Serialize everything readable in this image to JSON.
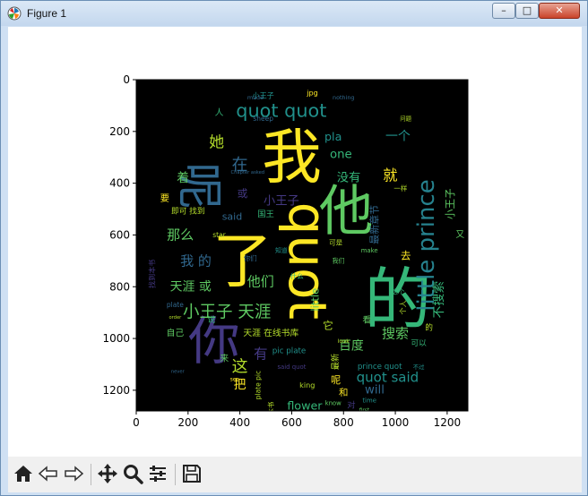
{
  "window": {
    "title": "Figure 1",
    "minimize_glyph": "–",
    "maximize_glyph": "□",
    "close_glyph": "✕",
    "app_icon": "matplotlib-logo-icon"
  },
  "toolbar": {
    "icons": [
      "home-icon",
      "back-arrow-icon",
      "forward-arrow-icon",
      "pan-move-icon",
      "zoom-magnifier-icon",
      "configure-subplots-icon",
      "save-floppy-icon"
    ]
  },
  "chart_data": {
    "type": "image",
    "description_kind": "word-cloud",
    "xlim": [
      0,
      1280
    ],
    "ylim": [
      1280,
      0
    ],
    "x_ticks": [
      0,
      200,
      400,
      600,
      800,
      1000,
      1200
    ],
    "y_ticks": [
      0,
      200,
      400,
      600,
      800,
      1000,
      1200
    ],
    "x_tick_labels": [
      "0",
      "200",
      "400",
      "600",
      "800",
      "1000",
      "1200"
    ],
    "y_tick_labels": [
      "0",
      "200",
      "400",
      "600",
      "800",
      "1000",
      "1200"
    ],
    "background_color": "#000000",
    "words": [
      {
        "text": "我",
        "x": 600,
        "y": 300,
        "size": 230,
        "color": "#fde725",
        "rotate": 0
      },
      {
        "text": "的",
        "x": 1010,
        "y": 850,
        "size": 260,
        "color": "#35b779",
        "rotate": 0
      },
      {
        "text": "quot",
        "x": 660,
        "y": 700,
        "size": 200,
        "color": "#fde725",
        "rotate": 90
      },
      {
        "text": "了",
        "x": 410,
        "y": 700,
        "size": 230,
        "color": "#fde725",
        "rotate": 0
      },
      {
        "text": "你",
        "x": 300,
        "y": 1010,
        "size": 200,
        "color": "#443983",
        "rotate": 0
      },
      {
        "text": "他",
        "x": 810,
        "y": 510,
        "size": 210,
        "color": "#5ec962",
        "rotate": 0
      },
      {
        "text": "呢",
        "x": 240,
        "y": 410,
        "size": 180,
        "color": "#31688e",
        "rotate": 90
      },
      {
        "text": "little prince",
        "x": 1120,
        "y": 640,
        "size": 90,
        "color": "#26828e",
        "rotate": -90
      },
      {
        "text": "quot quot",
        "x": 560,
        "y": 120,
        "size": 72,
        "color": "#21918c",
        "rotate": 0
      },
      {
        "text": "小王子 天涯",
        "x": 350,
        "y": 900,
        "size": 64,
        "color": "#5ec962",
        "rotate": 0
      },
      {
        "text": "quot said",
        "x": 970,
        "y": 1150,
        "size": 52,
        "color": "#21918c",
        "rotate": 0
      },
      {
        "text": "就",
        "x": 980,
        "y": 370,
        "size": 56,
        "color": "#fde725",
        "rotate": 0
      },
      {
        "text": "她",
        "x": 310,
        "y": 240,
        "size": 58,
        "color": "#b5de2b",
        "rotate": 0
      },
      {
        "text": "在",
        "x": 400,
        "y": 330,
        "size": 62,
        "color": "#31688e",
        "rotate": 0
      },
      {
        "text": "那么",
        "x": 170,
        "y": 600,
        "size": 52,
        "color": "#5ec962",
        "rotate": 0
      },
      {
        "text": "我 的",
        "x": 230,
        "y": 700,
        "size": 52,
        "color": "#31688e",
        "rotate": 0
      },
      {
        "text": "天涯 或",
        "x": 210,
        "y": 800,
        "size": 48,
        "color": "#5ec962",
        "rotate": 0
      },
      {
        "text": "他们",
        "x": 480,
        "y": 780,
        "size": 52,
        "color": "#5ec962",
        "rotate": 0
      },
      {
        "text": "小王子",
        "x": 560,
        "y": 470,
        "size": 46,
        "color": "#443983",
        "rotate": 0
      },
      {
        "text": "没有",
        "x": 820,
        "y": 380,
        "size": 46,
        "color": "#35b779",
        "rotate": 0
      },
      {
        "text": "one",
        "x": 790,
        "y": 290,
        "size": 46,
        "color": "#35b779",
        "rotate": 0
      },
      {
        "text": "一个",
        "x": 1010,
        "y": 220,
        "size": 48,
        "color": "#21918c",
        "rotate": 0
      },
      {
        "text": "这",
        "x": 400,
        "y": 1110,
        "size": 62,
        "color": "#b5de2b",
        "rotate": 0
      },
      {
        "text": "有",
        "x": 480,
        "y": 1060,
        "size": 54,
        "color": "#443983",
        "rotate": 0
      },
      {
        "text": "把",
        "x": 400,
        "y": 1180,
        "size": 48,
        "color": "#fde725",
        "rotate": 0
      },
      {
        "text": "百度",
        "x": 830,
        "y": 1030,
        "size": 48,
        "color": "#5ec962",
        "rotate": 0
      },
      {
        "text": "搜索",
        "x": 1000,
        "y": 980,
        "size": 52,
        "color": "#5ec962",
        "rotate": 0
      },
      {
        "text": "不搜索",
        "x": 1170,
        "y": 850,
        "size": 48,
        "color": "#35b779",
        "rotate": -90
      },
      {
        "text": "little",
        "x": 690,
        "y": 850,
        "size": 40,
        "color": "#5ec962",
        "rotate": -90
      },
      {
        "text": "will",
        "x": 920,
        "y": 1200,
        "size": 46,
        "color": "#31688e",
        "rotate": 0
      },
      {
        "text": "flower",
        "x": 650,
        "y": 1260,
        "size": 44,
        "color": "#35b779",
        "rotate": 0
      },
      {
        "text": "着",
        "x": 180,
        "y": 380,
        "size": 48,
        "color": "#5ec962",
        "rotate": 0
      },
      {
        "text": "pla",
        "x": 760,
        "y": 220,
        "size": 44,
        "color": "#21918c",
        "rotate": 0
      },
      {
        "text": "小王子",
        "x": 1210,
        "y": 480,
        "size": 40,
        "color": "#5ec962",
        "rotate": -90
      },
      {
        "text": "最新章节",
        "x": 920,
        "y": 560,
        "size": 38,
        "color": "#31688e",
        "rotate": -90
      },
      {
        "text": "said",
        "x": 370,
        "y": 530,
        "size": 38,
        "color": "#31688e",
        "rotate": 0
      },
      {
        "text": "或",
        "x": 410,
        "y": 440,
        "size": 40,
        "color": "#443983",
        "rotate": 0
      },
      {
        "text": "即可 找到",
        "x": 200,
        "y": 510,
        "size": 30,
        "color": "#b5de2b",
        "rotate": 0
      },
      {
        "text": "去",
        "x": 1040,
        "y": 680,
        "size": 40,
        "color": "#fde725",
        "rotate": 0
      },
      {
        "text": "天涯 在线书库",
        "x": 520,
        "y": 980,
        "size": 34,
        "color": "#b5de2b",
        "rotate": 0
      },
      {
        "text": "prince quot",
        "x": 940,
        "y": 1110,
        "size": 30,
        "color": "#21918c",
        "rotate": 0
      },
      {
        "text": "pic plate",
        "x": 590,
        "y": 1050,
        "size": 30,
        "color": "#21918c",
        "rotate": 0
      },
      {
        "text": "小王子",
        "x": 490,
        "y": 60,
        "size": 28,
        "color": "#21918c",
        "rotate": 0
      },
      {
        "text": "jpg",
        "x": 680,
        "y": 50,
        "size": 28,
        "color": "#fde725",
        "rotate": 0
      },
      {
        "text": "国王",
        "x": 500,
        "y": 520,
        "size": 32,
        "color": "#35b779",
        "rotate": 0
      },
      {
        "text": "star",
        "x": 320,
        "y": 600,
        "size": 26,
        "color": "#b5de2b",
        "rotate": 0
      },
      {
        "text": "make",
        "x": 900,
        "y": 660,
        "size": 24,
        "color": "#5ec962",
        "rotate": 0
      },
      {
        "text": "呢",
        "x": 770,
        "y": 1160,
        "size": 38,
        "color": "#fde725",
        "rotate": 0
      },
      {
        "text": "和",
        "x": 800,
        "y": 1210,
        "size": 36,
        "color": "#fde725",
        "rotate": 0
      },
      {
        "text": "king",
        "x": 660,
        "y": 1180,
        "size": 28,
        "color": "#b5de2b",
        "rotate": 0
      },
      {
        "text": "know",
        "x": 760,
        "y": 1250,
        "size": 24,
        "color": "#5ec962",
        "rotate": 0
      },
      {
        "text": "自己",
        "x": 150,
        "y": 980,
        "size": 34,
        "color": "#5ec962",
        "rotate": 0
      },
      {
        "text": "说",
        "x": 290,
        "y": 930,
        "size": 30,
        "color": "#35b779",
        "rotate": 0
      },
      {
        "text": "又",
        "x": 1250,
        "y": 600,
        "size": 34,
        "color": "#5ec962",
        "rotate": 0
      },
      {
        "text": "要",
        "x": 110,
        "y": 460,
        "size": 36,
        "color": "#fde725",
        "rotate": 0
      },
      {
        "text": "本书",
        "x": 520,
        "y": 1270,
        "size": 26,
        "color": "#b5de2b",
        "rotate": -90
      },
      {
        "text": "plate pic",
        "x": 470,
        "y": 1180,
        "size": 26,
        "color": "#b5de2b",
        "rotate": -90
      },
      {
        "text": "最新",
        "x": 770,
        "y": 1090,
        "size": 32,
        "color": "#b5de2b",
        "rotate": -90
      },
      {
        "text": "它",
        "x": 740,
        "y": 950,
        "size": 40,
        "color": "#b5de2b",
        "rotate": 0
      },
      {
        "text": "人",
        "x": 320,
        "y": 130,
        "size": 34,
        "color": "#35b779",
        "rotate": 0
      },
      {
        "text": "sheep",
        "x": 490,
        "y": 150,
        "size": 26,
        "color": "#31688e",
        "rotate": 0
      },
      {
        "text": "来",
        "x": 340,
        "y": 1080,
        "size": 34,
        "color": "#5ec962",
        "rotate": 0
      },
      {
        "text": "对",
        "x": 830,
        "y": 1260,
        "size": 32,
        "color": "#443983",
        "rotate": 0
      },
      {
        "text": "time",
        "x": 900,
        "y": 1240,
        "size": 24,
        "color": "#21918c",
        "rotate": 0
      },
      {
        "text": "看",
        "x": 890,
        "y": 930,
        "size": 34,
        "color": "#5ec962",
        "rotate": 0
      },
      {
        "text": "可以",
        "x": 1090,
        "y": 1020,
        "size": 30,
        "color": "#35b779",
        "rotate": 0
      },
      {
        "text": "的",
        "x": 1130,
        "y": 960,
        "size": 30,
        "color": "#b5de2b",
        "rotate": 0
      },
      {
        "text": "你们",
        "x": 440,
        "y": 690,
        "size": 26,
        "color": "#31688e",
        "rotate": 0
      },
      {
        "text": "可是",
        "x": 770,
        "y": 630,
        "size": 26,
        "color": "#b5de2b",
        "rotate": 0
      },
      {
        "text": "我们",
        "x": 780,
        "y": 700,
        "size": 24,
        "color": "#5ec962",
        "rotate": 0
      },
      {
        "text": "什么",
        "x": 620,
        "y": 760,
        "size": 26,
        "color": "#35b779",
        "rotate": 0
      },
      {
        "text": "nothing",
        "x": 800,
        "y": 70,
        "size": 22,
        "color": "#31688e",
        "rotate": 0
      },
      {
        "text": "made",
        "x": 460,
        "y": 70,
        "size": 22,
        "color": "#31688e",
        "rotate": 0
      },
      {
        "text": "said quot",
        "x": 600,
        "y": 1110,
        "size": 24,
        "color": "#443983",
        "rotate": 0
      },
      {
        "text": "look",
        "x": 800,
        "y": 1010,
        "size": 22,
        "color": "#b5de2b",
        "rotate": 0
      },
      {
        "text": "plate",
        "x": 150,
        "y": 870,
        "size": 26,
        "color": "#31688e",
        "rotate": 0
      },
      {
        "text": "找到本书",
        "x": 60,
        "y": 750,
        "size": 28,
        "color": "#443983",
        "rotate": -90
      },
      {
        "text": "Chapter asked",
        "x": 430,
        "y": 360,
        "size": 18,
        "color": "#31688e",
        "rotate": 0
      },
      {
        "text": "个人",
        "x": 1030,
        "y": 880,
        "size": 28,
        "color": "#b5de2b",
        "rotate": -90
      },
      {
        "text": "这个",
        "x": 1010,
        "y": 820,
        "size": 26,
        "color": "#35b779",
        "rotate": 0
      },
      {
        "text": "order",
        "x": 150,
        "y": 920,
        "size": 18,
        "color": "#b5de2b",
        "rotate": 0
      },
      {
        "text": "问题",
        "x": 1040,
        "y": 150,
        "size": 22,
        "color": "#b5de2b",
        "rotate": 0
      },
      {
        "text": "first",
        "x": 880,
        "y": 1280,
        "size": 20,
        "color": "#5ec962",
        "rotate": 0
      },
      {
        "text": "see",
        "x": 380,
        "y": 1160,
        "size": 20,
        "color": "#fde725",
        "rotate": 0
      },
      {
        "text": "never",
        "x": 160,
        "y": 1130,
        "size": 18,
        "color": "#31688e",
        "rotate": 0
      },
      {
        "text": "不过",
        "x": 1090,
        "y": 1110,
        "size": 22,
        "color": "#21918c",
        "rotate": 0
      },
      {
        "text": "知道",
        "x": 560,
        "y": 660,
        "size": 24,
        "color": "#21918c",
        "rotate": 0
      },
      {
        "text": "一样",
        "x": 1020,
        "y": 420,
        "size": 26,
        "color": "#b5de2b",
        "rotate": 0
      }
    ]
  }
}
